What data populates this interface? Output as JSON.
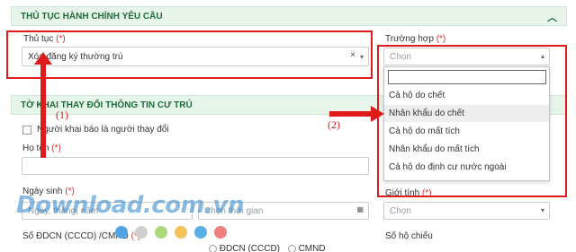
{
  "section1": {
    "title": "THỦ TỤC HÀNH CHÍNH YÊU CẦU",
    "collapse_icon": "chevron-up-icon"
  },
  "procedure": {
    "label": "Thủ tục",
    "required_mark": "(*)",
    "value": "Xóa đăng ký thường trú"
  },
  "case": {
    "label": "Trường hợp",
    "required_mark": "(*)",
    "placeholder": "Chọn"
  },
  "case_dropdown": {
    "options": [
      "Cả hộ do chết",
      "Nhân khẩu do chết",
      "Cả hộ do mất tích",
      "Nhân khẩu do mất tích",
      "Cả hộ do định cư nước ngoài"
    ],
    "highlighted_index": 1
  },
  "section2": {
    "title": "TỜ KHAI THAY ĐỔI THÔNG TIN CƯ TRÚ"
  },
  "declarant_checkbox": {
    "label": "Người khai báo là người thay đổi"
  },
  "full_name": {
    "label": "Họ tên",
    "required_mark": "(*)"
  },
  "birth_date": {
    "label": "Ngày sinh",
    "required_mark": "(*)",
    "placeholder": "Ngày, tháng, năm"
  },
  "time_field": {
    "placeholder": "Chọn thời gian"
  },
  "gender": {
    "label": "Giới tính",
    "required_mark": "(*)",
    "placeholder": "Chọn"
  },
  "id_number": {
    "label": "Số ĐDCN (CCCD) /CMND",
    "required_mark": "(*)",
    "option_cccd": "ĐDCN (CCCD)",
    "option_cmnd": "CMND"
  },
  "passport": {
    "label": "Số hộ chiếu"
  },
  "annotations": {
    "one": "(1)",
    "two": "(2)"
  },
  "watermark": {
    "text": "Download.com.vn"
  },
  "colors": {
    "highlight_red": "#e01b1b",
    "section_bg": "#e6f4ea",
    "section_text": "#1f6b3a"
  }
}
